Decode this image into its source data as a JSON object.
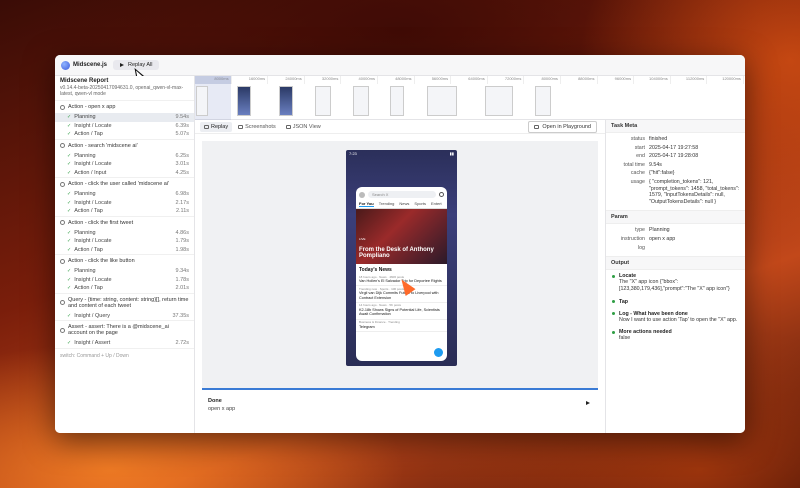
{
  "app": {
    "name": "Midscene.js",
    "replay_all": "Replay All"
  },
  "report": {
    "title": "Midscene Report",
    "subtitle": "v0.14.4-beta-20250417094631.0, openai_qwen-vl-max-latest, qwen-vl mode",
    "hint": "switch: Command + Up / Down"
  },
  "tasks": [
    {
      "title": "Action - open x app",
      "items": [
        {
          "label": "Planning",
          "duration": "9.54s",
          "active": true
        },
        {
          "label": "Insight / Locate",
          "duration": "6.39s"
        },
        {
          "label": "Action / Tap",
          "duration": "5.07s"
        }
      ]
    },
    {
      "title": "Action - search 'midscene ai'",
      "items": [
        {
          "label": "Planning",
          "duration": "6.25s"
        },
        {
          "label": "Insight / Locate",
          "duration": "3.01s"
        },
        {
          "label": "Action / Input",
          "duration": "4.25s"
        }
      ]
    },
    {
      "title": "Action - click the user called 'midscene ai'",
      "items": [
        {
          "label": "Planning",
          "duration": "6.98s"
        },
        {
          "label": "Insight / Locate",
          "duration": "2.17s"
        },
        {
          "label": "Action / Tap",
          "duration": "2.11s"
        }
      ]
    },
    {
      "title": "Action - click the first tweet",
      "items": [
        {
          "label": "Planning",
          "duration": "4.86s"
        },
        {
          "label": "Insight / Locate",
          "duration": "1.79s"
        },
        {
          "label": "Action / Tap",
          "duration": "1.98s"
        }
      ]
    },
    {
      "title": "Action - click the like button",
      "items": [
        {
          "label": "Planning",
          "duration": "9.34s"
        },
        {
          "label": "Insight / Locate",
          "duration": "1.78s"
        },
        {
          "label": "Action / Tap",
          "duration": "2.01s"
        }
      ]
    },
    {
      "title": "Query - {time: string, content: string}[], return time and content of each tweet",
      "items": [
        {
          "label": "Insight / Query",
          "duration": "37.35s"
        }
      ]
    },
    {
      "title": "Assert - assert: There is a @midscene_ai account on the page",
      "items": [
        {
          "label": "Insight / Assert",
          "duration": "2.72s"
        }
      ]
    }
  ],
  "timeline": {
    "ticks": [
      "8000ms",
      "16000ms",
      "24000ms",
      "32000ms",
      "40000ms",
      "48000ms",
      "56000ms",
      "64000ms",
      "72000ms",
      "80000ms",
      "88000ms",
      "96000ms",
      "104000ms",
      "112000ms",
      "120000ms"
    ]
  },
  "center": {
    "tabs": [
      "Replay",
      "Screenshots",
      "JSON View"
    ],
    "playground": "Open in Playground",
    "done_title": "Done",
    "done_sub": "open x app"
  },
  "phone": {
    "time": "7:23",
    "search": "Search X",
    "tabs": [
      "For You",
      "Trending",
      "News",
      "Sports",
      "Entert"
    ],
    "hero_live": "LIVE",
    "hero_title": "From the Desk of Anthony Pompliano",
    "news_heading": "Today's News",
    "news": [
      {
        "title": "Van Hollen's El Salvador Trip for Deportee Rights",
        "meta": "18 hours ago · News · 4606 posts"
      },
      {
        "title": "Virgil van Dijk Commits Future to Liverpool with Contract Extension",
        "meta": "Trending now · Sports · 106 posts"
      },
      {
        "title": "K2-18b Shows Signs of Potential Life, Scientists Await Confirmation",
        "meta": "14 hours ago · News · 5K posts"
      },
      {
        "title": "Telegram",
        "meta": "Business & Finance · Trending"
      }
    ]
  },
  "task_meta": {
    "title": "Task Meta",
    "rows": [
      {
        "k": "status",
        "v": "finished"
      },
      {
        "k": "start",
        "v": "2025-04-17 19:27:58"
      },
      {
        "k": "end",
        "v": "2025-04-17 19:28:08"
      },
      {
        "k": "total time",
        "v": "9.54s"
      },
      {
        "k": "cache",
        "v": "{\"hit\":false}"
      },
      {
        "k": "usage",
        "v": "{ \"completion_tokens\": 121, \"prompt_tokens\": 1458, \"total_tokens\": 1579, \"InputTokensDetails\": null, \"OutputTokensDetails\": null }"
      }
    ]
  },
  "param": {
    "title": "Param",
    "rows": [
      {
        "k": "type",
        "v": "Planning"
      },
      {
        "k": "instruction",
        "v": "open x app"
      },
      {
        "k": "log",
        "v": ""
      }
    ]
  },
  "output": {
    "title": "Output",
    "items": [
      {
        "head": "Locate",
        "body": "The \"X\" app icon {\"bbox\":[123,380,179,436],\"prompt\":\"The \"X\" app icon\"}"
      },
      {
        "head": "Tap",
        "body": ""
      },
      {
        "head": "Log - What have been done",
        "body": "Now I want to use action 'Tap' to open the \"X\" app."
      },
      {
        "head": "More actions needed",
        "body": "false"
      }
    ]
  }
}
